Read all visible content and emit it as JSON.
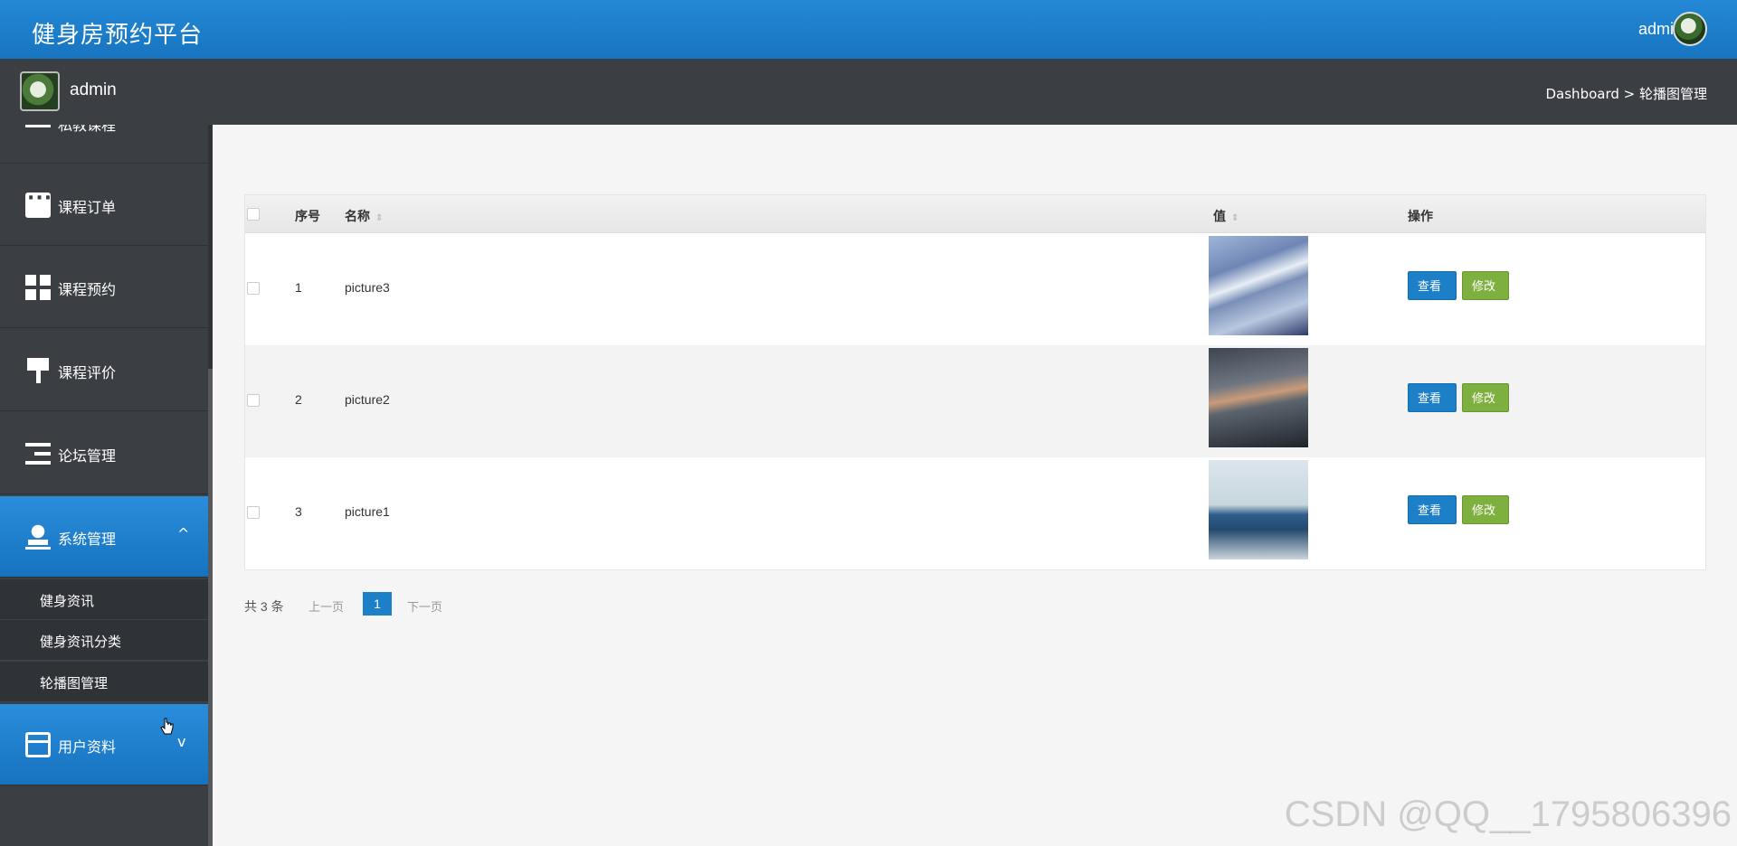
{
  "header": {
    "brand": "健身房预约平台",
    "user": "admin"
  },
  "subbar": {
    "name": "admin",
    "breadcrumb": "Dashboard > 轮播图管理"
  },
  "sidebar": {
    "items": [
      {
        "label": "私教课程",
        "icon": "edit-icon"
      },
      {
        "label": "课程订单",
        "icon": "chat-bubble-icon"
      },
      {
        "label": "课程预约",
        "icon": "grid-icon"
      },
      {
        "label": "课程评价",
        "icon": "brush-icon"
      },
      {
        "label": "论坛管理",
        "icon": "list-icon"
      },
      {
        "label": "系统管理",
        "icon": "user-stamp-icon",
        "chevron": "^"
      },
      {
        "label": "用户资料",
        "icon": "card-icon",
        "chevron": "v"
      }
    ],
    "subitems": [
      "健身资讯",
      "健身资讯分类",
      "轮播图管理"
    ]
  },
  "table": {
    "headers": {
      "index": "序号",
      "name": "名称",
      "value": "值",
      "action": "操作"
    },
    "rows": [
      {
        "index": "1",
        "name": "picture3",
        "image": "mountain-image"
      },
      {
        "index": "2",
        "name": "picture2",
        "image": "swimmer-image"
      },
      {
        "index": "3",
        "name": "picture1",
        "image": "plank-image"
      }
    ],
    "view_label": "查看",
    "edit_label": "修改"
  },
  "pager": {
    "total": "共 3 条",
    "prev": "上一页",
    "page": "1",
    "next": "下一页"
  },
  "watermark": "CSDN @QQ__1795806396",
  "colors": {
    "primary": "#1e7fc9",
    "success": "#7eb03f",
    "sidebar": "#3b3e42"
  }
}
